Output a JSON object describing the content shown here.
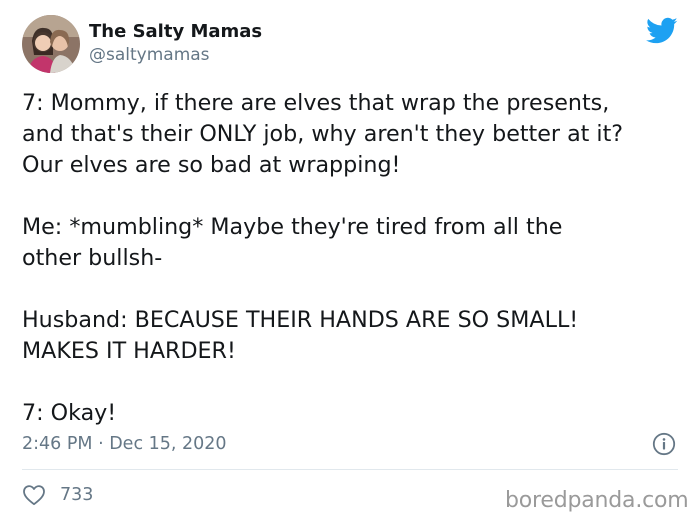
{
  "author": {
    "display_name": "The Salty Mamas",
    "handle": "@saltymamas"
  },
  "tweet": {
    "paragraphs": [
      "7: Mommy, if there are elves that wrap the presents,\nand that's their ONLY job, why aren't they better at it?\nOur elves are so bad at wrapping!",
      "Me: *mumbling* Maybe they're tired from all the\nother bullsh-",
      "Husband: BECAUSE THEIR HANDS ARE SO SMALL!\nMAKES IT HARDER!",
      "7: Okay!"
    ],
    "timestamp": "2:46 PM · Dec 15, 2020",
    "like_count": "733"
  },
  "watermark": "boredpanda.com",
  "colors": {
    "twitter_blue": "#1da1f2",
    "text": "#14171a",
    "muted": "#657786",
    "divider": "#e1e8ed"
  },
  "icons": {
    "brand": "twitter-bird-icon",
    "info": "info-icon",
    "like": "heart-icon"
  }
}
